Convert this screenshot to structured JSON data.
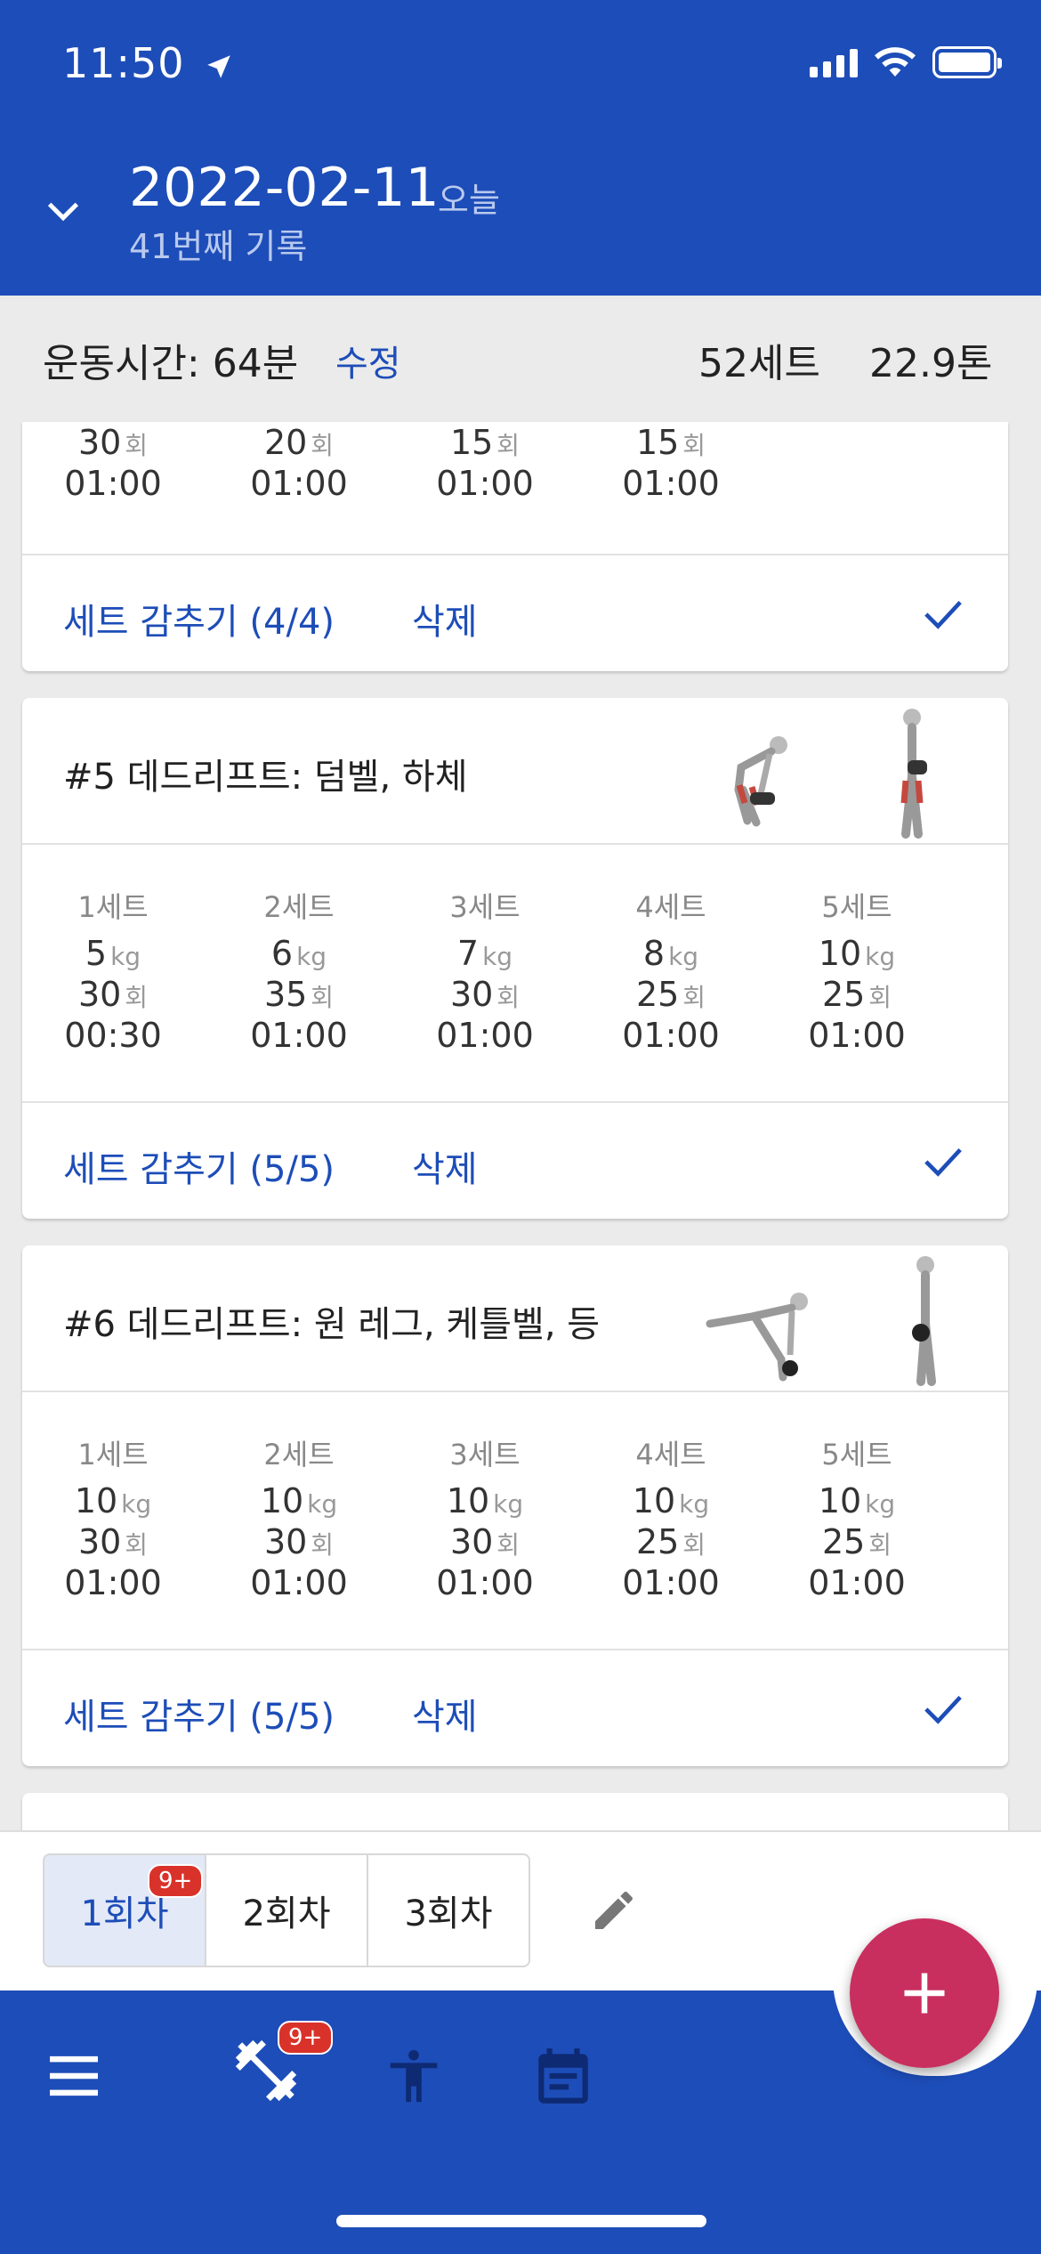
{
  "colors": {
    "primary": "#1d4db8",
    "fab": "#c92f5e",
    "badge": "#d9322a"
  },
  "status_bar": {
    "time": "11:50"
  },
  "header": {
    "date": "2022-02-11",
    "today_label": "오늘",
    "record_count": "41번째 기록"
  },
  "summary": {
    "workout_time": "운동시간: 64분",
    "edit_label": "수정",
    "total_sets": "52세트",
    "total_tons": "22.9톤"
  },
  "cards": [
    {
      "sets": [
        {
          "reps": "30",
          "time": "01:00"
        },
        {
          "reps": "20",
          "time": "01:00"
        },
        {
          "reps": "15",
          "time": "01:00"
        },
        {
          "reps": "15",
          "time": "01:00"
        }
      ],
      "hide_label": "세트 감추기 (4/4)",
      "delete_label": "삭제"
    },
    {
      "title": "#5 데드리프트: 덤벨, 하체",
      "sets": [
        {
          "label": "1세트",
          "weight": "5",
          "reps": "30",
          "time": "00:30"
        },
        {
          "label": "2세트",
          "weight": "6",
          "reps": "35",
          "time": "01:00"
        },
        {
          "label": "3세트",
          "weight": "7",
          "reps": "30",
          "time": "01:00"
        },
        {
          "label": "4세트",
          "weight": "8",
          "reps": "25",
          "time": "01:00"
        },
        {
          "label": "5세트",
          "weight": "10",
          "reps": "25",
          "time": "01:00"
        }
      ],
      "hide_label": "세트 감추기 (5/5)",
      "delete_label": "삭제"
    },
    {
      "title": "#6 데드리프트: 원 레그, 케틀벨, 등",
      "sets": [
        {
          "label": "1세트",
          "weight": "10",
          "reps": "30",
          "time": "01:00"
        },
        {
          "label": "2세트",
          "weight": "10",
          "reps": "30",
          "time": "01:00"
        },
        {
          "label": "3세트",
          "weight": "10",
          "reps": "30",
          "time": "01:00"
        },
        {
          "label": "4세트",
          "weight": "10",
          "reps": "25",
          "time": "01:00"
        },
        {
          "label": "5세트",
          "weight": "10",
          "reps": "25",
          "time": "01:00"
        }
      ],
      "hide_label": "세트 감추기 (5/5)",
      "delete_label": "삭제"
    }
  ],
  "units": {
    "kg": "kg",
    "reps": "회"
  },
  "routine_tabs": [
    "1회차",
    "2회차",
    "3회차"
  ],
  "badges": {
    "routine": "9+",
    "nav": "9+"
  },
  "nav": {
    "icons": [
      "menu-icon",
      "dumbbell-icon",
      "body-icon",
      "calendar-icon"
    ],
    "fab": "+"
  }
}
